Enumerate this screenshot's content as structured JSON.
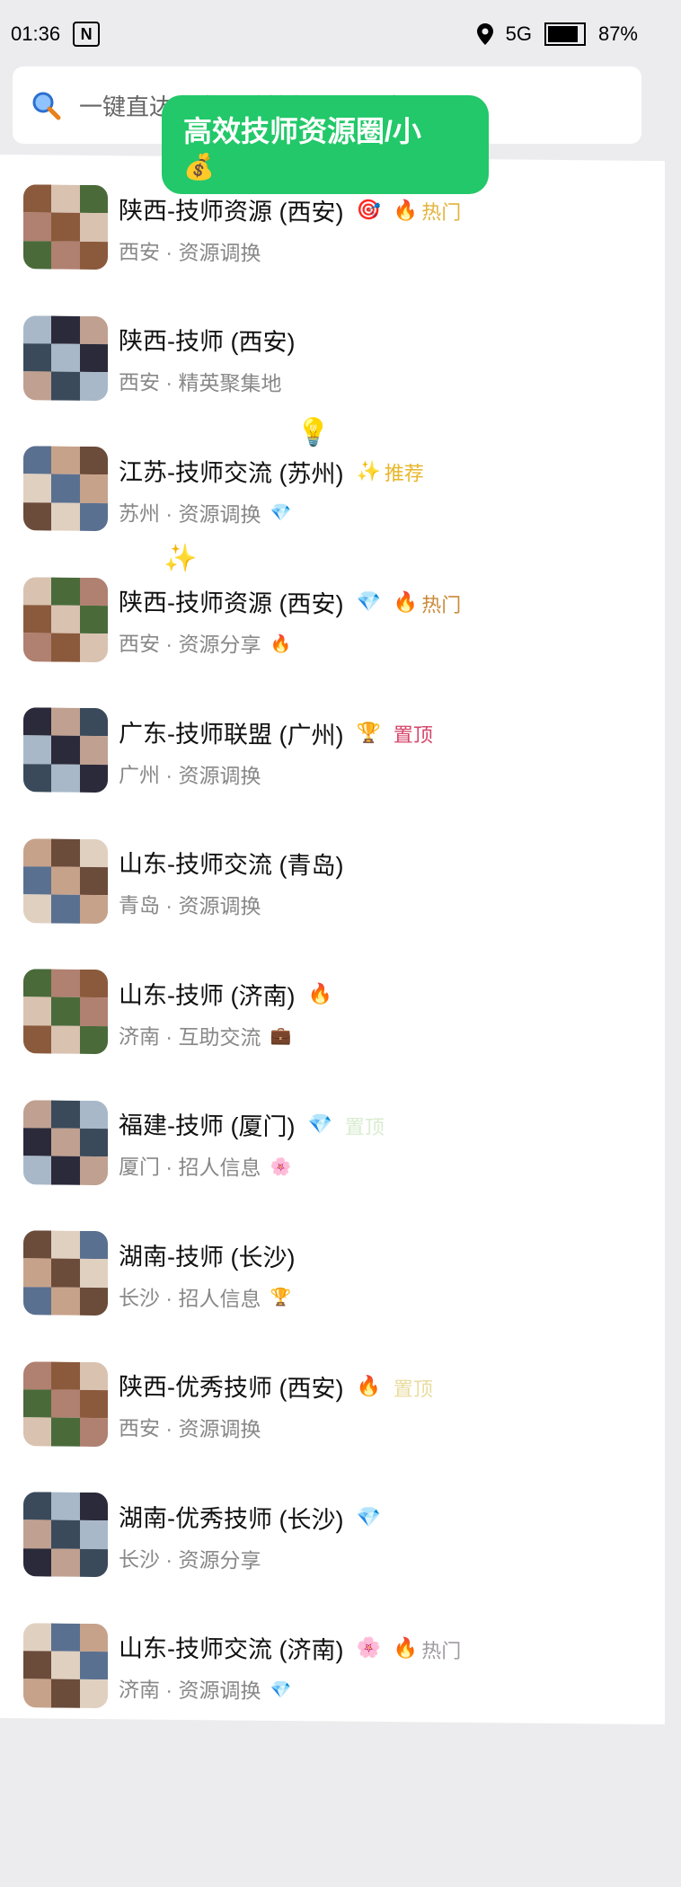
{
  "status": {
    "time": "01:36",
    "notif": "N",
    "network": "5G",
    "battery": "87%",
    "battery_level": 0.87
  },
  "search": {
    "text": "一键直达，全区域技师资源共享"
  },
  "banner": {
    "title": "高效技师资源圈/小",
    "emoji": "💰"
  },
  "colors": {
    "hot": "#e8a23a",
    "recommend": "#e8b62a",
    "pin": "#d6456a",
    "pin_faded": "#e9dca0",
    "hot_faded": "#a09aa0"
  },
  "rows": [
    {
      "title": "陕西-技师资源 (西安)",
      "t_emoji": "🎯",
      "tag_icon": "🔥",
      "tag": "热门",
      "tag_color": "#e3b33b",
      "sub": "西安 · 资源调换",
      "s_emoji": ""
    },
    {
      "title": "陕西-技师 (西安)",
      "t_emoji": "",
      "tag_icon": "",
      "tag": "",
      "tag_color": "",
      "sub": "西安 · 精英聚集地",
      "s_emoji": ""
    },
    {
      "title": "江苏-技师交流 (苏州)",
      "t_emoji": "",
      "tag_icon": "✨",
      "tag": "推荐",
      "tag_color": "#e8b62a",
      "sub": "苏州 · 资源调换",
      "s_emoji": "💎"
    },
    {
      "title": "陕西-技师资源 (西安)",
      "t_emoji": "💎",
      "tag_icon": "🔥",
      "tag": "热门",
      "tag_color": "#c98a3a",
      "sub": "西安 · 资源分享",
      "s_emoji": "🔥"
    },
    {
      "title": "广东-技师联盟 (广州)",
      "t_emoji": "🏆",
      "tag_icon": "",
      "tag": "置顶",
      "tag_color": "#d6456a",
      "sub": "广州 · 资源调换",
      "s_emoji": ""
    },
    {
      "title": "山东-技师交流 (青岛)",
      "t_emoji": "",
      "tag_icon": "",
      "tag": "",
      "tag_color": "",
      "sub": "青岛 · 资源调换",
      "s_emoji": ""
    },
    {
      "title": "山东-技师 (济南)",
      "t_emoji": "🔥",
      "tag_icon": "",
      "tag": "",
      "tag_color": "",
      "sub": "济南 · 互助交流",
      "s_emoji": "💼"
    },
    {
      "title": "福建-技师 (厦门)",
      "t_emoji": "💎",
      "tag_icon": "",
      "tag": "置顶",
      "tag_color": "#d9ecd0",
      "sub": "厦门 · 招人信息",
      "s_emoji": "🌸"
    },
    {
      "title": "湖南-技师 (长沙)",
      "t_emoji": "",
      "tag_icon": "",
      "tag": "",
      "tag_color": "",
      "sub": "长沙 · 招人信息",
      "s_emoji": "🏆"
    },
    {
      "title": "陕西-优秀技师 (西安)",
      "t_emoji": "🔥",
      "tag_icon": "",
      "tag": "置顶",
      "tag_color": "#e9dca0",
      "sub": "西安 · 资源调换",
      "s_emoji": ""
    },
    {
      "title": "湖南-优秀技师 (长沙)",
      "t_emoji": "💎",
      "tag_icon": "",
      "tag": "",
      "tag_color": "",
      "sub": "长沙 · 资源分享",
      "s_emoji": ""
    },
    {
      "title": "山东-技师交流 (济南)",
      "t_emoji": "🌸",
      "tag_icon": "🔥",
      "tag": "热门",
      "tag_color": "#a09aa0",
      "sub": "济南 · 资源调换",
      "s_emoji": "💎"
    }
  ],
  "floating": {
    "bulb": "💡",
    "sparkle": "✨"
  }
}
